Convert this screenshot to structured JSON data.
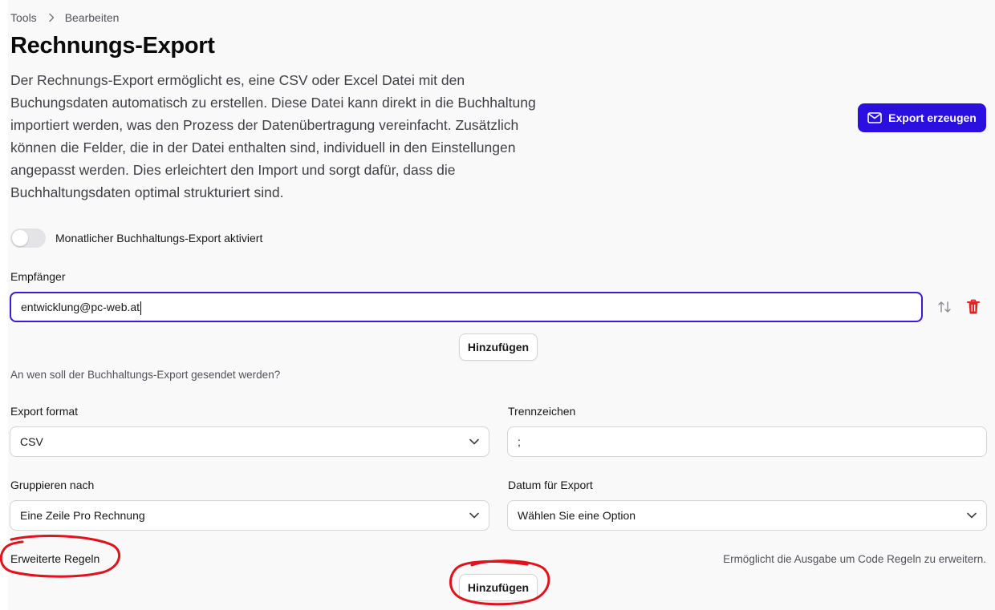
{
  "breadcrumb": {
    "root": "Tools",
    "current": "Bearbeiten"
  },
  "page": {
    "title": "Rechnungs-Export",
    "description": "Der Rechnungs-Export ermöglicht es, eine CSV oder Excel Datei mit den Buchungsdaten automatisch zu erstellen. Diese Datei kann direkt in die Buchhaltung importiert werden, was den Prozess der Datenübertragung vereinfacht. Zusätzlich können die Felder, die in der Datei enthalten sind, individuell in den Einstellungen angepasst werden. Dies erleichtert den Import und sorgt dafür, dass die Buchhaltungsdaten optimal strukturiert sind."
  },
  "actions": {
    "export_label": "Export erzeugen"
  },
  "monthly_export": {
    "label": "Monatlicher Buchhaltungs-Export aktiviert",
    "enabled": false
  },
  "recipients": {
    "label": "Empfänger",
    "items": [
      {
        "email": "entwicklung@pc-web.at"
      }
    ],
    "add_label": "Hinzufügen",
    "help": "An wen soll der Buchhaltungs-Export gesendet werden?"
  },
  "export_format": {
    "label": "Export format",
    "value": "CSV"
  },
  "separator": {
    "label": "Trennzeichen",
    "value": ";"
  },
  "group_by": {
    "label": "Gruppieren nach",
    "value": "Eine Zeile Pro Rechnung"
  },
  "export_date": {
    "label": "Datum für Export",
    "value": "Wählen Sie eine Option"
  },
  "advanced_rules": {
    "label": "Erweiterte Regeln",
    "hint": "Ermöglicht die Ausgabe um Code Regeln zu erweitern.",
    "add_label": "Hinzufügen"
  },
  "colors": {
    "primary": "#2a0fe0",
    "danger": "#dc2626",
    "annotation": "#e0121b"
  }
}
